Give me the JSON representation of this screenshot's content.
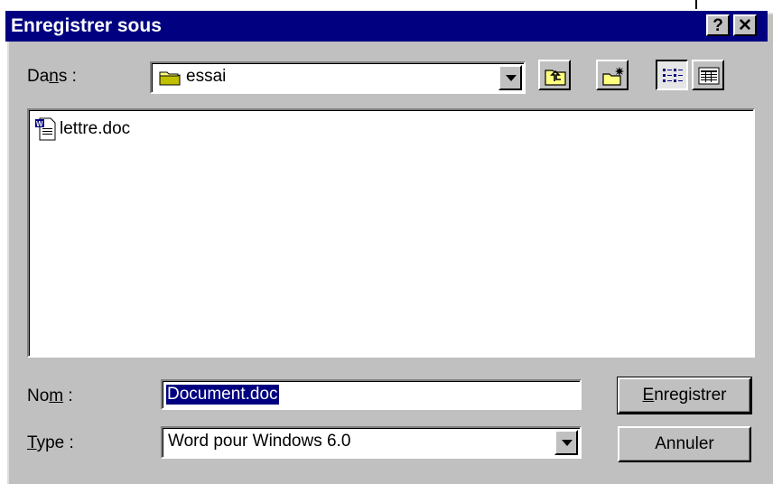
{
  "window": {
    "title": "Enregistrer sous",
    "help_glyph": "?",
    "close_glyph": "✕"
  },
  "location": {
    "label_before": "Da",
    "label_accel": "n",
    "label_after": "s :",
    "current_folder": "essai"
  },
  "toolbar": {
    "icons": [
      "up-one-level-icon",
      "new-folder-icon",
      "list-view-icon",
      "details-view-icon"
    ]
  },
  "files": [
    {
      "name": "lettre.doc",
      "icon": "word-document-icon"
    }
  ],
  "filename": {
    "label_before": "No",
    "label_accel": "m",
    "label_after": " :",
    "value": "Document.doc"
  },
  "filetype": {
    "label_accel": "T",
    "label_after": "ype :",
    "value": "Word pour Windows 6.0"
  },
  "buttons": {
    "save_accel": "E",
    "save_rest": "nregistrer",
    "cancel": "Annuler"
  },
  "colors": {
    "titlebar": "#000080",
    "face": "#c0c0c0",
    "selection": "#000080"
  }
}
